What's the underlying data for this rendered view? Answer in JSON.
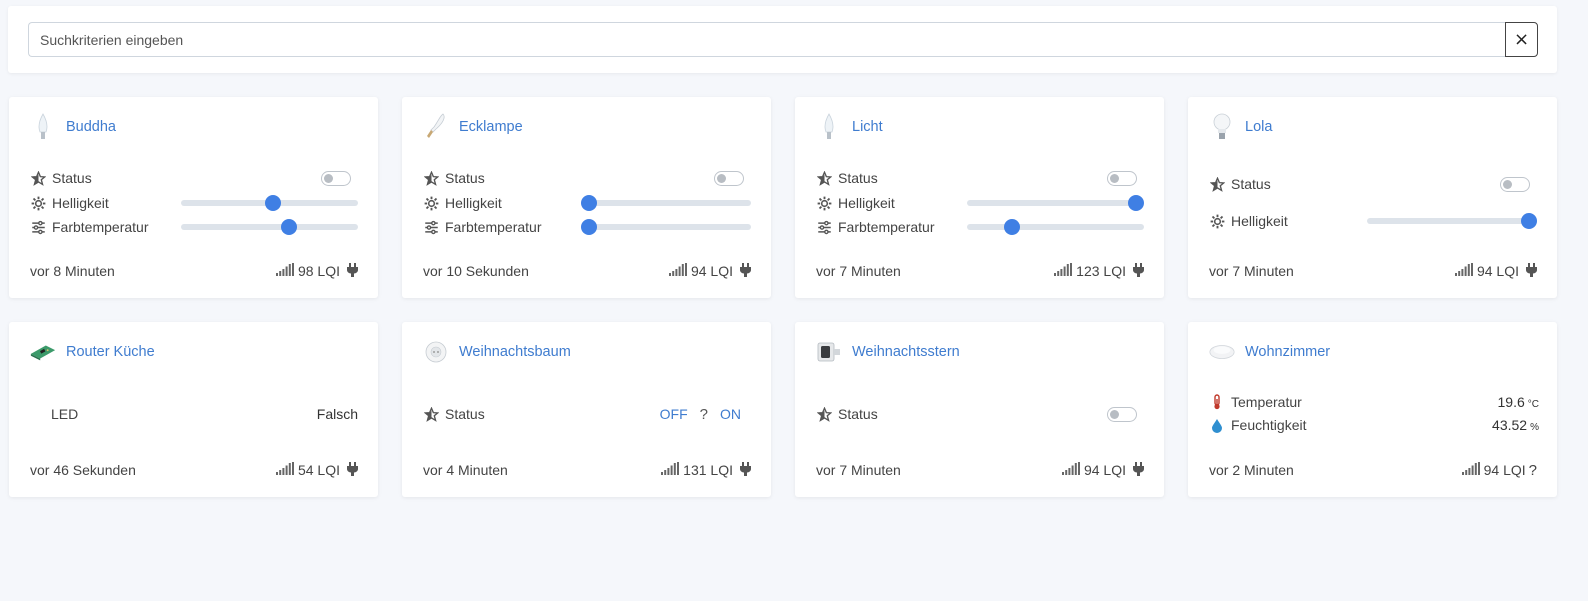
{
  "search": {
    "placeholder": "Suchkriterien eingeben",
    "clear_label": "×"
  },
  "devices": [
    {
      "name": "Buddha",
      "status_label": "Status",
      "brightness_label": "Helligkeit",
      "brightness": 0.52,
      "colortemp_label": "Farbtemperatur",
      "colortemp": 0.62,
      "last_seen": "vor 8 Minuten",
      "lqi": "98 LQI"
    },
    {
      "name": "Ecklampe",
      "status_label": "Status",
      "brightness_label": "Helligkeit",
      "brightness": 0.0,
      "colortemp_label": "Farbtemperatur",
      "colortemp": 0.0,
      "last_seen": "vor 10 Sekunden",
      "lqi": "94 LQI"
    },
    {
      "name": "Licht",
      "status_label": "Status",
      "brightness_label": "Helligkeit",
      "brightness": 1.0,
      "colortemp_label": "Farbtemperatur",
      "colortemp": 0.23,
      "last_seen": "vor 7 Minuten",
      "lqi": "123 LQI"
    },
    {
      "name": "Lola",
      "status_label": "Status",
      "brightness_label": "Helligkeit",
      "brightness": 1.0,
      "last_seen": "vor 7 Minuten",
      "lqi": "94 LQI"
    },
    {
      "name": "Router Küche",
      "led_label": "LED",
      "led_value": "Falsch",
      "last_seen": "vor 46 Sekunden",
      "lqi": "54 LQI"
    },
    {
      "name": "Weihnachtsbaum",
      "status_label": "Status",
      "off_label": "OFF",
      "unknown_label": "?",
      "on_label": "ON",
      "last_seen": "vor 4 Minuten",
      "lqi": "131 LQI"
    },
    {
      "name": "Weihnachtsstern",
      "status_label": "Status",
      "last_seen": "vor 7 Minuten",
      "lqi": "94 LQI"
    },
    {
      "name": "Wohnzimmer",
      "temp_label": "Temperatur",
      "temp_value": "19.6",
      "temp_unit": "°C",
      "hum_label": "Feuchtigkeit",
      "hum_value": "43.52",
      "hum_unit": "%",
      "last_seen": "vor 2 Minuten",
      "lqi": "94 LQI",
      "power_unknown": "?"
    }
  ],
  "colors": {
    "accent": "#3f7fe4",
    "link": "#3f7ccf",
    "track": "#dde3ea"
  }
}
